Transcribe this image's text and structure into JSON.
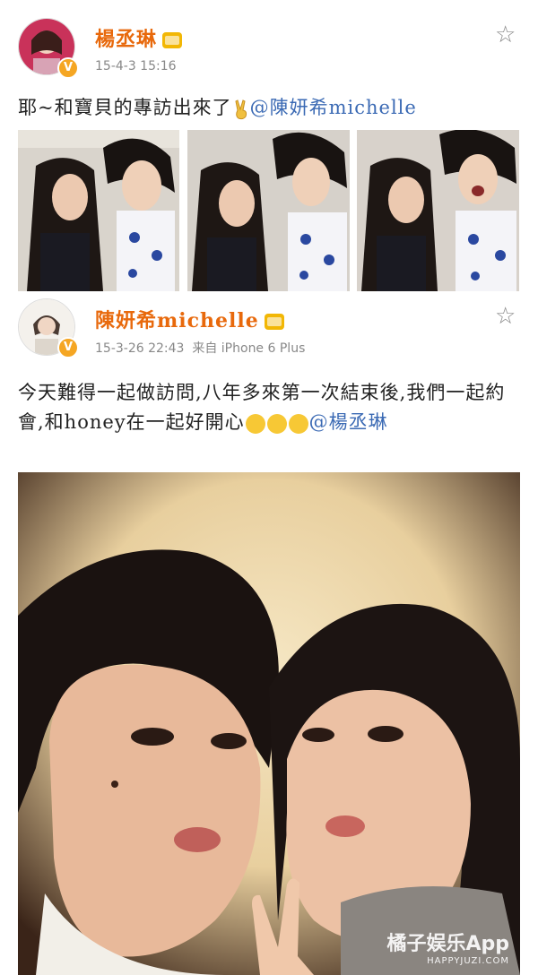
{
  "post1": {
    "username": "楊丞琳",
    "timestamp": "15-4-3 15:16",
    "text": "耶~和寶貝的專訪出來了",
    "mention": "@陳妍希michelle"
  },
  "post2": {
    "username": "陳妍希michelle",
    "timestamp": "15-3-26 22:43",
    "source": "来自 iPhone 6 Plus",
    "text": "今天難得一起做訪問,八年多來第一次結束後,我們一起約會,和honey在一起好開心",
    "mention": "@楊丞琳"
  },
  "badge": "V",
  "watermark": {
    "brand": "橘子娱乐App",
    "site": "HAPPYJUZI.COM"
  },
  "icons": {
    "favorite": "star-outline-icon",
    "verified": "verified-badge-icon",
    "member": "crown-icon"
  },
  "colors": {
    "username": "#e8690c",
    "mention": "#3b6ab4",
    "meta": "#888888"
  }
}
